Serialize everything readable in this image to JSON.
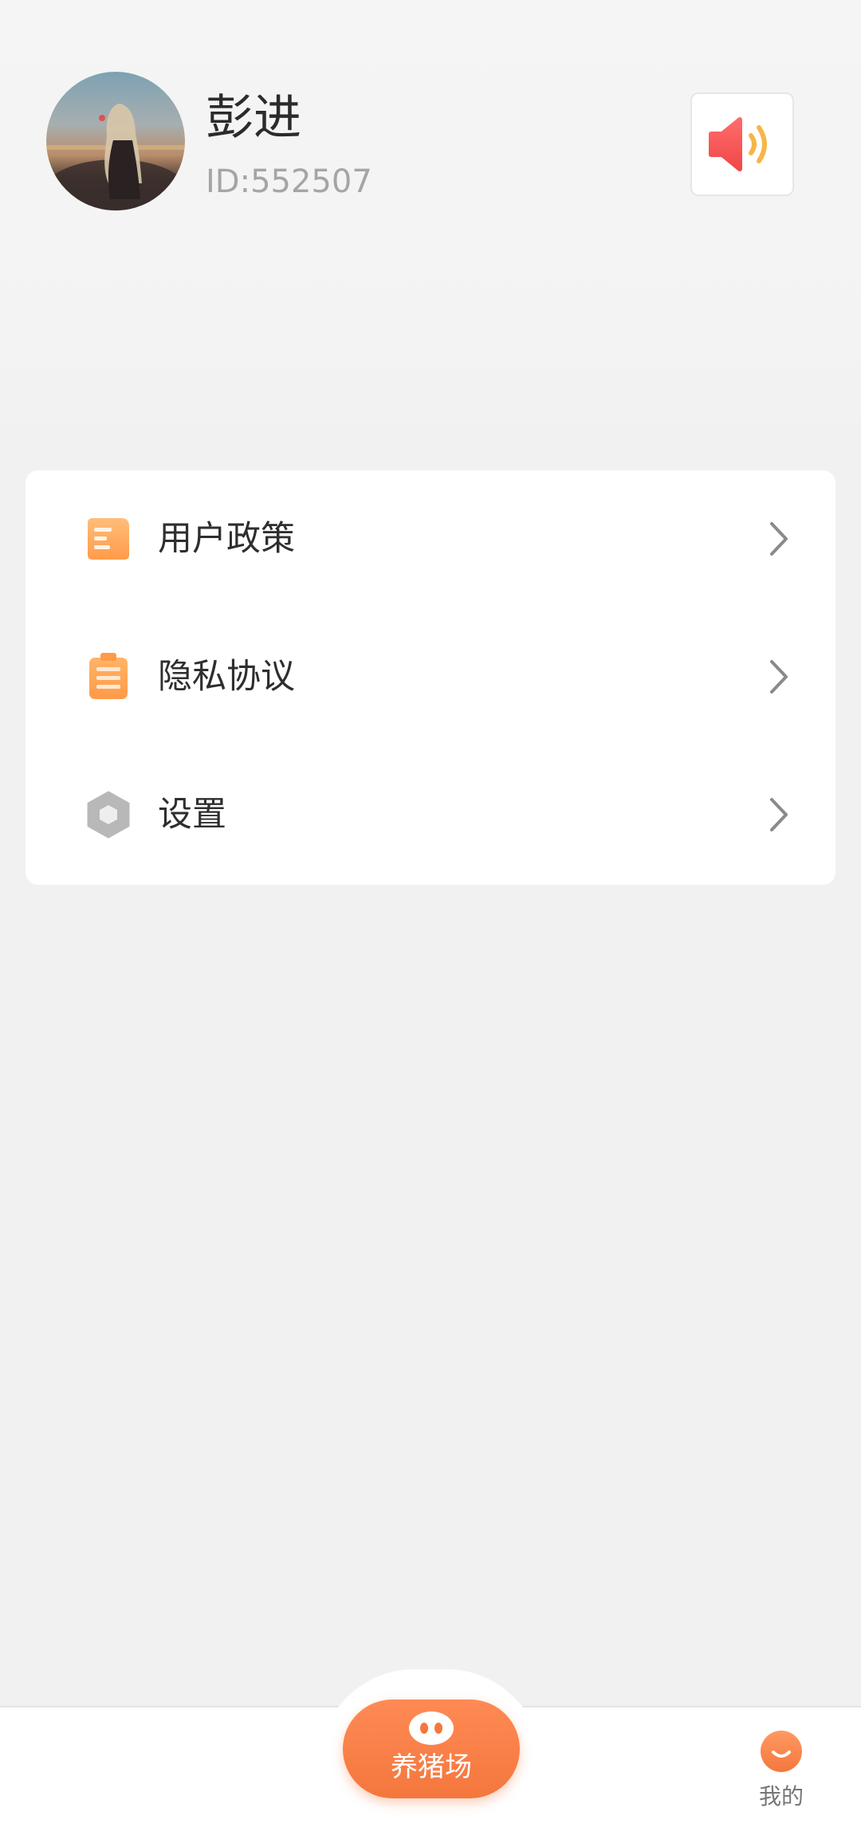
{
  "profile": {
    "name": "彭进",
    "id_text": "ID:552507"
  },
  "sound_button": {
    "icon": "speaker-icon"
  },
  "menu": {
    "items": [
      {
        "label": "用户政策",
        "icon": "document-icon"
      },
      {
        "label": "隐私协议",
        "icon": "clipboard-icon"
      },
      {
        "label": "设置",
        "icon": "hexagon-settings-icon"
      }
    ]
  },
  "tabbar": {
    "center_label": "养猪场",
    "mine_label": "我的"
  },
  "colors": {
    "accent": "#f4773d",
    "page_background": "#f1f1f1"
  }
}
